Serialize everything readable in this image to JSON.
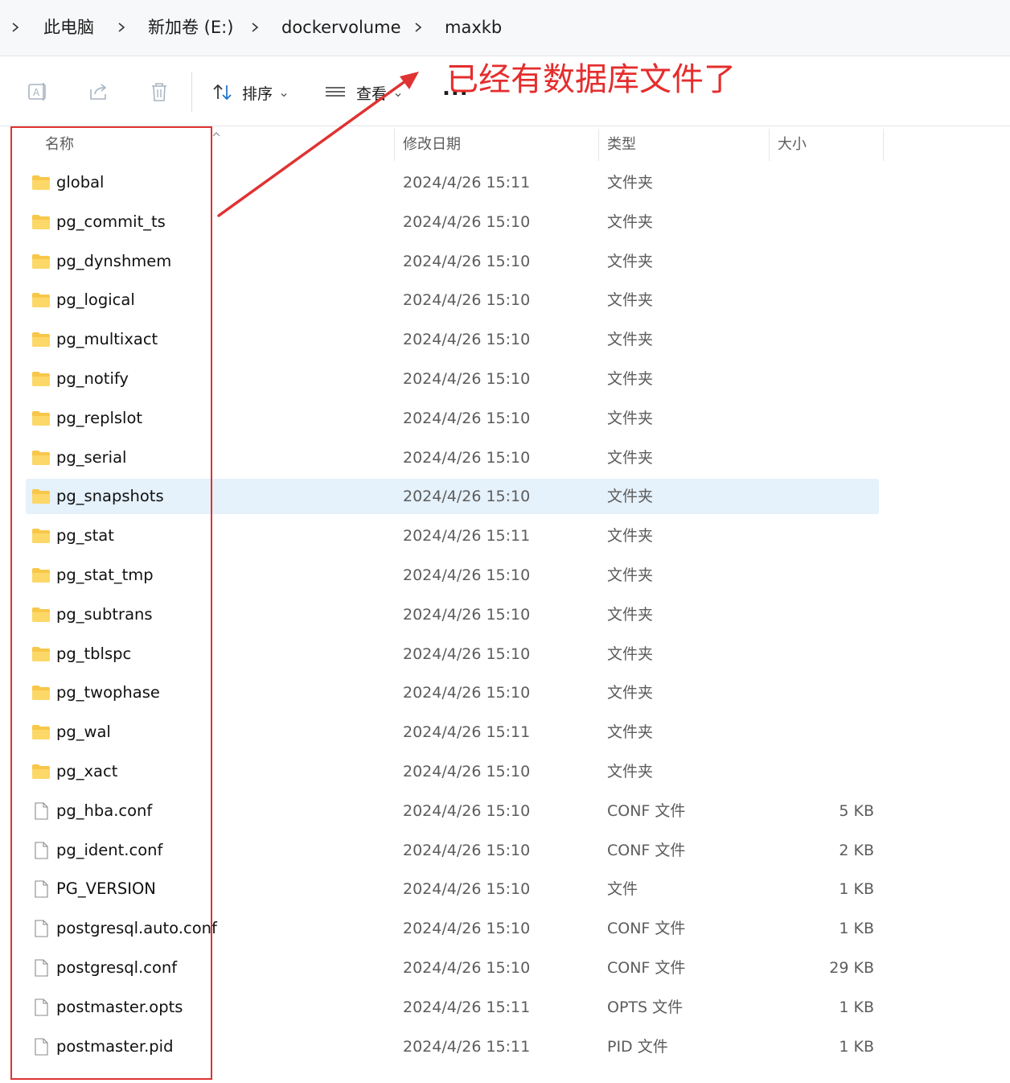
{
  "breadcrumb": {
    "items": [
      "此电脑",
      "新加卷 (E:)",
      "dockervolume",
      "maxkb"
    ]
  },
  "toolbar": {
    "sort_label": "排序",
    "view_label": "查看",
    "more_label": "..."
  },
  "annotation": {
    "text": "已经有数据库文件了",
    "color": "#e52d2d"
  },
  "columns": {
    "name": "名称",
    "date": "修改日期",
    "type": "类型",
    "size": "大小"
  },
  "files": [
    {
      "name": "global",
      "date": "2024/4/26 15:11",
      "type": "文件夹",
      "size": "",
      "kind": "folder"
    },
    {
      "name": "pg_commit_ts",
      "date": "2024/4/26 15:10",
      "type": "文件夹",
      "size": "",
      "kind": "folder"
    },
    {
      "name": "pg_dynshmem",
      "date": "2024/4/26 15:10",
      "type": "文件夹",
      "size": "",
      "kind": "folder"
    },
    {
      "name": "pg_logical",
      "date": "2024/4/26 15:10",
      "type": "文件夹",
      "size": "",
      "kind": "folder"
    },
    {
      "name": "pg_multixact",
      "date": "2024/4/26 15:10",
      "type": "文件夹",
      "size": "",
      "kind": "folder"
    },
    {
      "name": "pg_notify",
      "date": "2024/4/26 15:10",
      "type": "文件夹",
      "size": "",
      "kind": "folder"
    },
    {
      "name": "pg_replslot",
      "date": "2024/4/26 15:10",
      "type": "文件夹",
      "size": "",
      "kind": "folder"
    },
    {
      "name": "pg_serial",
      "date": "2024/4/26 15:10",
      "type": "文件夹",
      "size": "",
      "kind": "folder"
    },
    {
      "name": "pg_snapshots",
      "date": "2024/4/26 15:10",
      "type": "文件夹",
      "size": "",
      "kind": "folder",
      "selected": true
    },
    {
      "name": "pg_stat",
      "date": "2024/4/26 15:11",
      "type": "文件夹",
      "size": "",
      "kind": "folder"
    },
    {
      "name": "pg_stat_tmp",
      "date": "2024/4/26 15:10",
      "type": "文件夹",
      "size": "",
      "kind": "folder"
    },
    {
      "name": "pg_subtrans",
      "date": "2024/4/26 15:10",
      "type": "文件夹",
      "size": "",
      "kind": "folder"
    },
    {
      "name": "pg_tblspc",
      "date": "2024/4/26 15:10",
      "type": "文件夹",
      "size": "",
      "kind": "folder"
    },
    {
      "name": "pg_twophase",
      "date": "2024/4/26 15:10",
      "type": "文件夹",
      "size": "",
      "kind": "folder"
    },
    {
      "name": "pg_wal",
      "date": "2024/4/26 15:11",
      "type": "文件夹",
      "size": "",
      "kind": "folder"
    },
    {
      "name": "pg_xact",
      "date": "2024/4/26 15:10",
      "type": "文件夹",
      "size": "",
      "kind": "folder"
    },
    {
      "name": "pg_hba.conf",
      "date": "2024/4/26 15:10",
      "type": "CONF 文件",
      "size": "5 KB",
      "kind": "file"
    },
    {
      "name": "pg_ident.conf",
      "date": "2024/4/26 15:10",
      "type": "CONF 文件",
      "size": "2 KB",
      "kind": "file"
    },
    {
      "name": "PG_VERSION",
      "date": "2024/4/26 15:10",
      "type": "文件",
      "size": "1 KB",
      "kind": "file"
    },
    {
      "name": "postgresql.auto.conf",
      "date": "2024/4/26 15:10",
      "type": "CONF 文件",
      "size": "1 KB",
      "kind": "file"
    },
    {
      "name": "postgresql.conf",
      "date": "2024/4/26 15:10",
      "type": "CONF 文件",
      "size": "29 KB",
      "kind": "file"
    },
    {
      "name": "postmaster.opts",
      "date": "2024/4/26 15:11",
      "type": "OPTS 文件",
      "size": "1 KB",
      "kind": "file"
    },
    {
      "name": "postmaster.pid",
      "date": "2024/4/26 15:11",
      "type": "PID 文件",
      "size": "1 KB",
      "kind": "file"
    }
  ],
  "colors": {
    "folder": "#f8c74a",
    "selection": "#e5f1fb",
    "annotation_red": "#e03232"
  }
}
